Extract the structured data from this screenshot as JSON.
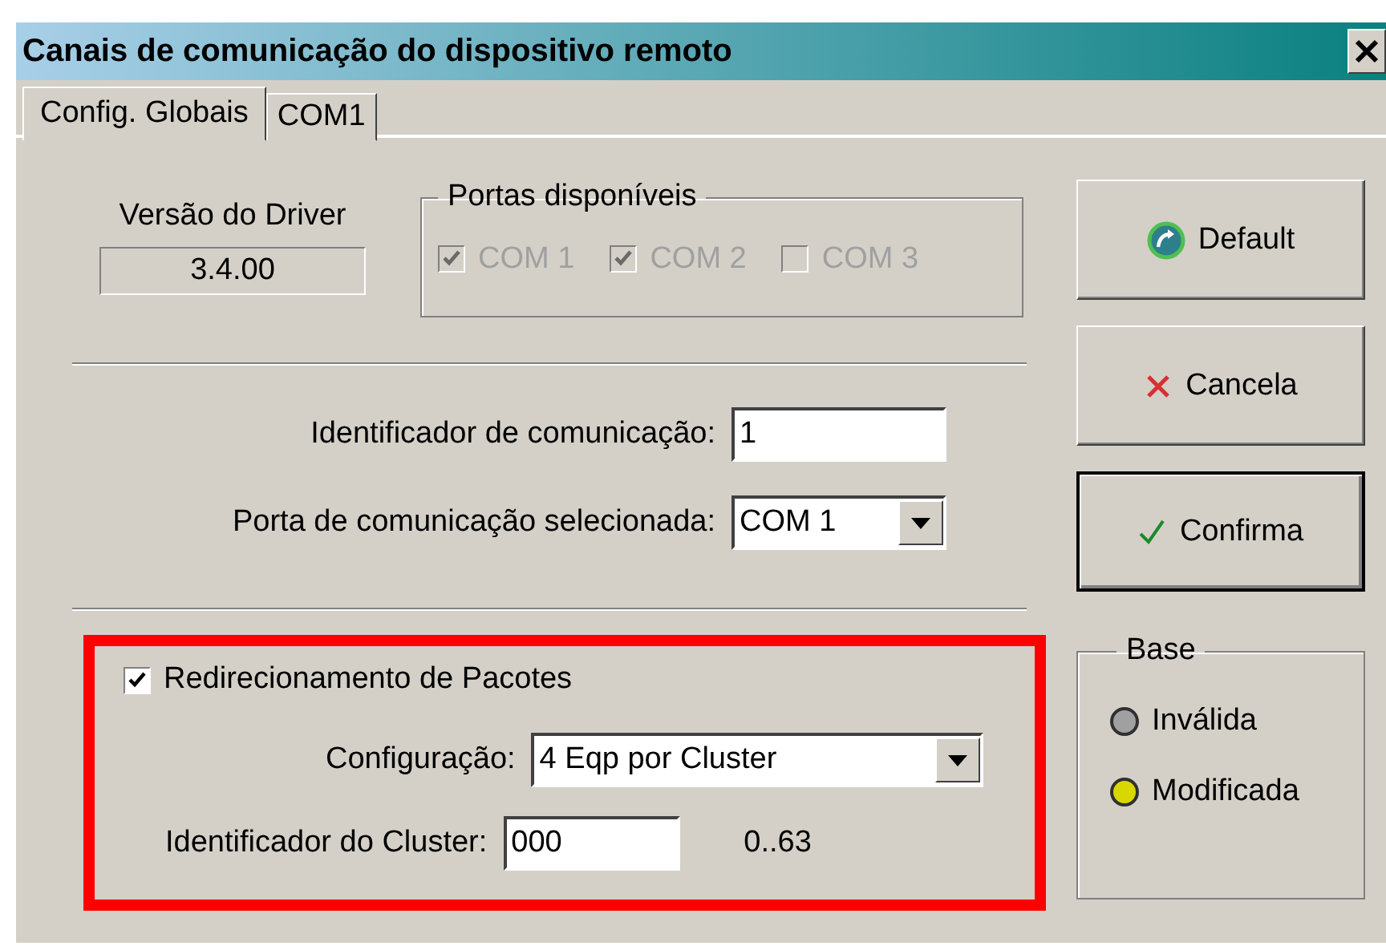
{
  "window": {
    "title": "Canais de comunicação do dispositivo remoto"
  },
  "tabs": [
    {
      "label": "Config. Globais",
      "selected": true
    },
    {
      "label": "COM1",
      "selected": false
    }
  ],
  "driver_version": {
    "label": "Versão do Driver",
    "value": "3.4.00"
  },
  "ports_group": {
    "title": "Portas disponíveis",
    "ports": [
      {
        "label": "COM 1",
        "checked": true,
        "disabled": true
      },
      {
        "label": "COM 2",
        "checked": true,
        "disabled": true
      },
      {
        "label": "COM 3",
        "checked": false,
        "disabled": true
      }
    ]
  },
  "comm_id": {
    "label": "Identificador de comunicação:",
    "value": "1"
  },
  "selected_port": {
    "label": "Porta de comunicação selecionada:",
    "value": "COM 1"
  },
  "redirect": {
    "label": "Redirecionamento de Pacotes",
    "checked": true,
    "highlighted": true
  },
  "configuration": {
    "label": "Configuração:",
    "value": "4 Eqp por Cluster"
  },
  "cluster_id": {
    "label": "Identificador do Cluster:",
    "value": "000",
    "range": "0..63"
  },
  "buttons": [
    {
      "label": "Default",
      "kind": "default",
      "focused": false
    },
    {
      "label": "Cancela",
      "kind": "cancel",
      "focused": false
    },
    {
      "label": "Confirma",
      "kind": "confirm",
      "focused": true
    }
  ],
  "base_group": {
    "title": "Base",
    "indicators": [
      {
        "label": "Inválida",
        "color": "#a0a0a0"
      },
      {
        "label": "Modificada",
        "color": "#d8d800"
      }
    ]
  }
}
